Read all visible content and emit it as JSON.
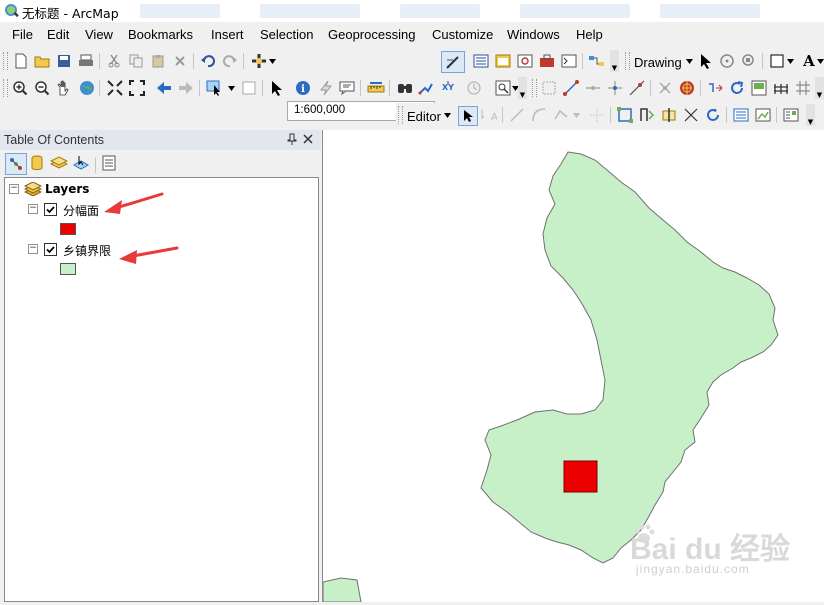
{
  "app": {
    "title": "无标题 - ArcMap"
  },
  "menu": {
    "items": [
      "File",
      "Edit",
      "View",
      "Bookmarks",
      "Insert",
      "Selection",
      "Geoprocessing",
      "Customize",
      "Windows",
      "Help"
    ]
  },
  "standard_toolbar": {
    "scale_value": "1:600,000"
  },
  "drawing_toolbar": {
    "label": "Drawing"
  },
  "editor_toolbar": {
    "label": "Editor"
  },
  "toc": {
    "title": "Table Of Contents",
    "root_label": "Layers",
    "layers": [
      {
        "name": "分幅面",
        "checked": true,
        "swatch_color": "#ee0000"
      },
      {
        "name": "乡镇界限",
        "checked": true,
        "swatch_color": "#c8f0c8"
      }
    ]
  },
  "map": {
    "polygon_fill": "#c8f0c8",
    "polygon_stroke": "#707070",
    "frame_fill": "#ee0000"
  },
  "annotation_color": "#e83a3a",
  "watermark": {
    "brand": "Bai du 经验",
    "url": "jingyan.baidu.com"
  }
}
